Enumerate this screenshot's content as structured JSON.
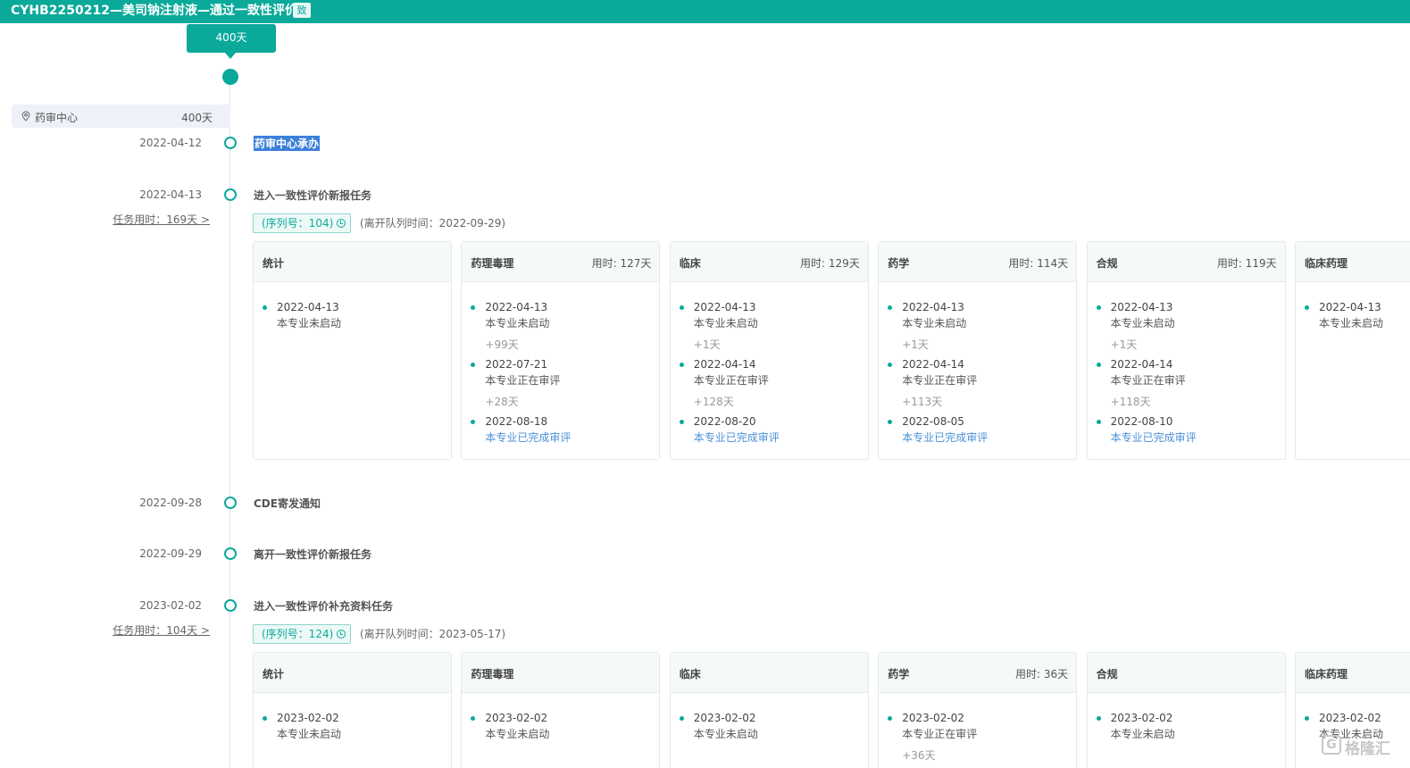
{
  "header": {
    "title": "CYHB2250212—美司钠注射液—通过一致性评价",
    "badge": "致"
  },
  "top_tip": "400天",
  "center": {
    "name": "药审中心",
    "days": "400天"
  },
  "events": [
    {
      "date": "2022-04-12",
      "label": "药审中心承办"
    },
    {
      "date": "2022-04-13",
      "label": "进入一致性评价新报任务",
      "task_link": "任务用时：169天 >"
    },
    {
      "date": "2022-09-28",
      "label": "CDE寄发通知"
    },
    {
      "date": "2022-09-29",
      "label": "离开一致性评价新报任务"
    },
    {
      "date": "2023-02-02",
      "label": "进入一致性评价补充资料任务",
      "task_link": "任务用时：104天 >"
    }
  ],
  "task1": {
    "seq": "(序列号：104)",
    "leave": "(离开队列时间：2022-09-29)",
    "cards": [
      {
        "name": "统计",
        "used": "",
        "items": [
          {
            "date": "2022-04-13",
            "status": "本专业未启动"
          }
        ],
        "gaps": []
      },
      {
        "name": "药理毒理",
        "used": "用时: 127天",
        "items": [
          {
            "date": "2022-04-13",
            "status": "本专业未启动"
          },
          {
            "date": "2022-07-21",
            "status": "本专业正在审评"
          },
          {
            "date": "2022-08-18",
            "status": "本专业已完成审评"
          }
        ],
        "gaps": [
          "+99天",
          "+28天"
        ]
      },
      {
        "name": "临床",
        "used": "用时: 129天",
        "items": [
          {
            "date": "2022-04-13",
            "status": "本专业未启动"
          },
          {
            "date": "2022-04-14",
            "status": "本专业正在审评"
          },
          {
            "date": "2022-08-20",
            "status": "本专业已完成审评"
          }
        ],
        "gaps": [
          "+1天",
          "+128天"
        ]
      },
      {
        "name": "药学",
        "used": "用时: 114天",
        "items": [
          {
            "date": "2022-04-13",
            "status": "本专业未启动"
          },
          {
            "date": "2022-04-14",
            "status": "本专业正在审评"
          },
          {
            "date": "2022-08-05",
            "status": "本专业已完成审评"
          }
        ],
        "gaps": [
          "+1天",
          "+113天"
        ]
      },
      {
        "name": "合规",
        "used": "用时: 119天",
        "items": [
          {
            "date": "2022-04-13",
            "status": "本专业未启动"
          },
          {
            "date": "2022-04-14",
            "status": "本专业正在审评"
          },
          {
            "date": "2022-08-10",
            "status": "本专业已完成审评"
          }
        ],
        "gaps": [
          "+1天",
          "+118天"
        ]
      },
      {
        "name": "临床药理",
        "used": "",
        "items": [
          {
            "date": "2022-04-13",
            "status": "本专业未启动"
          }
        ],
        "gaps": []
      }
    ]
  },
  "task2": {
    "seq": "(序列号：124)",
    "leave": "(离开队列时间：2023-05-17)",
    "cards": [
      {
        "name": "统计",
        "used": "",
        "items": [
          {
            "date": "2023-02-02",
            "status": "本专业未启动"
          }
        ],
        "gaps": []
      },
      {
        "name": "药理毒理",
        "used": "",
        "items": [
          {
            "date": "2023-02-02",
            "status": "本专业未启动"
          }
        ],
        "gaps": []
      },
      {
        "name": "临床",
        "used": "",
        "items": [
          {
            "date": "2023-02-02",
            "status": "本专业未启动"
          }
        ],
        "gaps": []
      },
      {
        "name": "药学",
        "used": "用时: 36天",
        "items": [
          {
            "date": "2023-02-02",
            "status": "本专业正在审评"
          }
        ],
        "gaps": [
          "+36天"
        ]
      },
      {
        "name": "合规",
        "used": "",
        "items": [
          {
            "date": "2023-02-02",
            "status": "本专业未启动"
          }
        ],
        "gaps": []
      },
      {
        "name": "临床药理",
        "used": "",
        "items": [
          {
            "date": "2023-02-02",
            "status": "本专业未启动"
          }
        ],
        "gaps": []
      }
    ]
  },
  "watermark": {
    "icon": "G",
    "text": "格隆汇"
  }
}
